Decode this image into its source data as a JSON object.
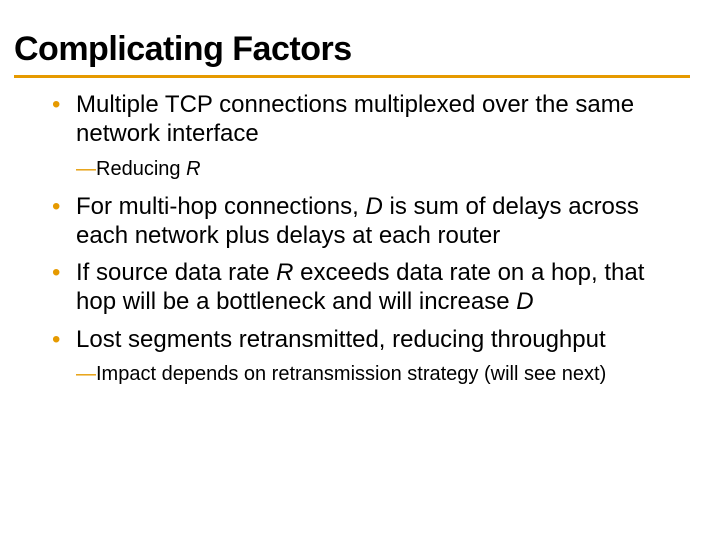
{
  "title": "Complicating Factors",
  "bullets": {
    "b1": {
      "text_a": "Multiple TCP connections multiplexed over the same network interface",
      "sub_a_pre": "Reducing ",
      "sub_a_var": "R"
    },
    "b2": {
      "pre": "For multi-hop connections, ",
      "var1": "D",
      "post": " is sum of delays across each network plus delays at each router"
    },
    "b3": {
      "pre": "If source data rate ",
      "var1": "R",
      "mid": " exceeds data rate on a hop, that hop will be a bottleneck and will increase ",
      "var2": "D"
    },
    "b4": {
      "text": "Lost segments retransmitted, reducing throughput",
      "sub_a": "Impact depends on retransmission strategy (will see next)"
    }
  },
  "dash": "—"
}
